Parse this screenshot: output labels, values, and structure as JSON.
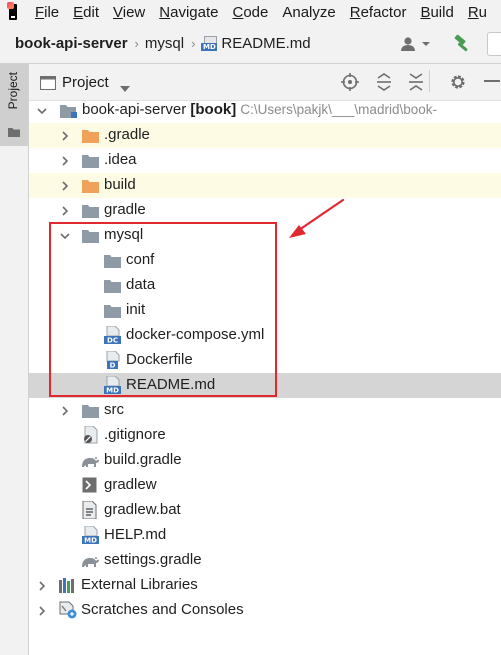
{
  "menu": {
    "items": [
      {
        "mnemonic": "F",
        "rest": "ile"
      },
      {
        "mnemonic": "E",
        "rest": "dit"
      },
      {
        "mnemonic": "V",
        "rest": "iew"
      },
      {
        "mnemonic": "N",
        "rest": "avigate"
      },
      {
        "mnemonic": "C",
        "rest": "ode"
      },
      {
        "mnemonic": "",
        "rest": "Analyze"
      },
      {
        "mnemonic": "R",
        "rest": "efactor"
      },
      {
        "mnemonic": "B",
        "rest": "uild"
      },
      {
        "mnemonic": "R",
        "rest": "u"
      }
    ]
  },
  "navbar": {
    "crumbs": [
      "book-api-server",
      "mysql",
      "README.md"
    ]
  },
  "sidebar": {
    "project_tab_label": "Project"
  },
  "toolwindow": {
    "title": "Project"
  },
  "tree": {
    "root_name": "book-api-server",
    "root_module": "[book]",
    "root_path": "C:\\Users\\pakjk\\___\\madrid\\book-",
    "items": [
      {
        "label": "book-api-server",
        "icon": "module-folder-icon"
      },
      {
        "label": ".gradle",
        "icon": "orange-folder-icon"
      },
      {
        "label": ".idea",
        "icon": "folder-icon"
      },
      {
        "label": "build",
        "icon": "orange-folder-icon"
      },
      {
        "label": "gradle",
        "icon": "folder-icon"
      },
      {
        "label": "mysql",
        "icon": "folder-icon"
      },
      {
        "label": "conf",
        "icon": "folder-icon"
      },
      {
        "label": "data",
        "icon": "folder-icon"
      },
      {
        "label": "init",
        "icon": "folder-icon"
      },
      {
        "label": "docker-compose.yml",
        "icon": "docker-compose-file-icon",
        "badge": "DC"
      },
      {
        "label": "Dockerfile",
        "icon": "dockerfile-icon",
        "badge": "D"
      },
      {
        "label": "README.md",
        "icon": "markdown-file-icon",
        "badge": "MD"
      },
      {
        "label": "src",
        "icon": "folder-icon"
      },
      {
        "label": ".gitignore",
        "icon": "gitignore-file-icon"
      },
      {
        "label": "build.gradle",
        "icon": "gradle-elephant-icon"
      },
      {
        "label": "gradlew",
        "icon": "shell-script-icon"
      },
      {
        "label": "gradlew.bat",
        "icon": "batch-file-icon"
      },
      {
        "label": "HELP.md",
        "icon": "markdown-file-icon",
        "badge": "MD"
      },
      {
        "label": "settings.gradle",
        "icon": "gradle-elephant-icon"
      },
      {
        "label": "External Libraries",
        "icon": "external-libraries-icon"
      },
      {
        "label": "Scratches and Consoles",
        "icon": "scratches-icon"
      }
    ]
  },
  "colors": {
    "highlight": "#e0282e",
    "selected_row": "#d5d5d5",
    "excluded_row": "#fdfbe4",
    "folder": "#8e9aa5",
    "excluded_folder": "#f0a25a",
    "file_badge": "#3d73b8"
  }
}
